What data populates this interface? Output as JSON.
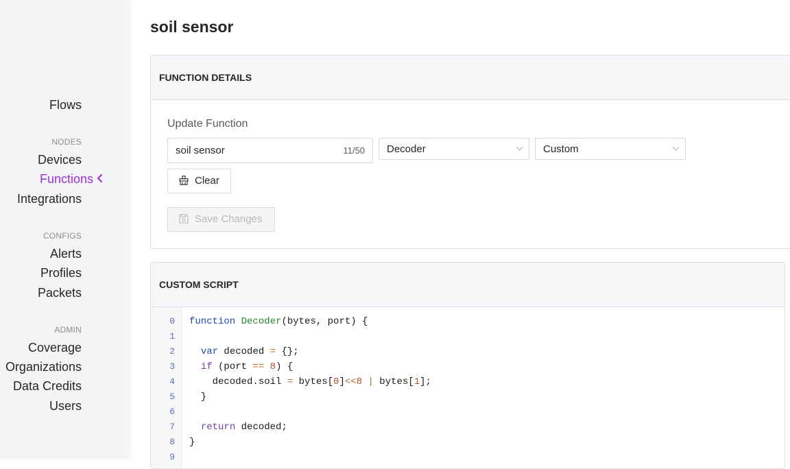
{
  "sidebar": {
    "flows": "Flows",
    "nodes_header": "NODES",
    "devices": "Devices",
    "functions": "Functions",
    "integrations": "Integrations",
    "configs_header": "CONFIGS",
    "alerts": "Alerts",
    "profiles": "Profiles",
    "packets": "Packets",
    "admin_header": "ADMIN",
    "coverage": "Coverage",
    "organizations": "Organizations",
    "data_credits": "Data Credits",
    "users": "Users",
    "active_item": "Functions",
    "accent_color": "#9b30d9"
  },
  "page": {
    "title": "soil sensor"
  },
  "function_details": {
    "header": "FUNCTION DETAILS",
    "update_label": "Update Function",
    "name_value": "soil sensor",
    "name_counter": "11/50",
    "type_select": "Decoder",
    "format_select": "Custom",
    "clear_label": "Clear",
    "save_label": "Save Changes"
  },
  "custom_script": {
    "header": "CUSTOM SCRIPT",
    "line_numbers": [
      "0",
      "1",
      "2",
      "3",
      "4",
      "5",
      "6",
      "7",
      "8",
      "9"
    ],
    "lines": [
      "function Decoder(bytes, port) {",
      "",
      "  var decoded = {};",
      "  if (port == 8) {",
      "    decoded.soil = bytes[0]<<8 | bytes[1];",
      "  }",
      "",
      "  return decoded;",
      "}",
      ""
    ]
  }
}
